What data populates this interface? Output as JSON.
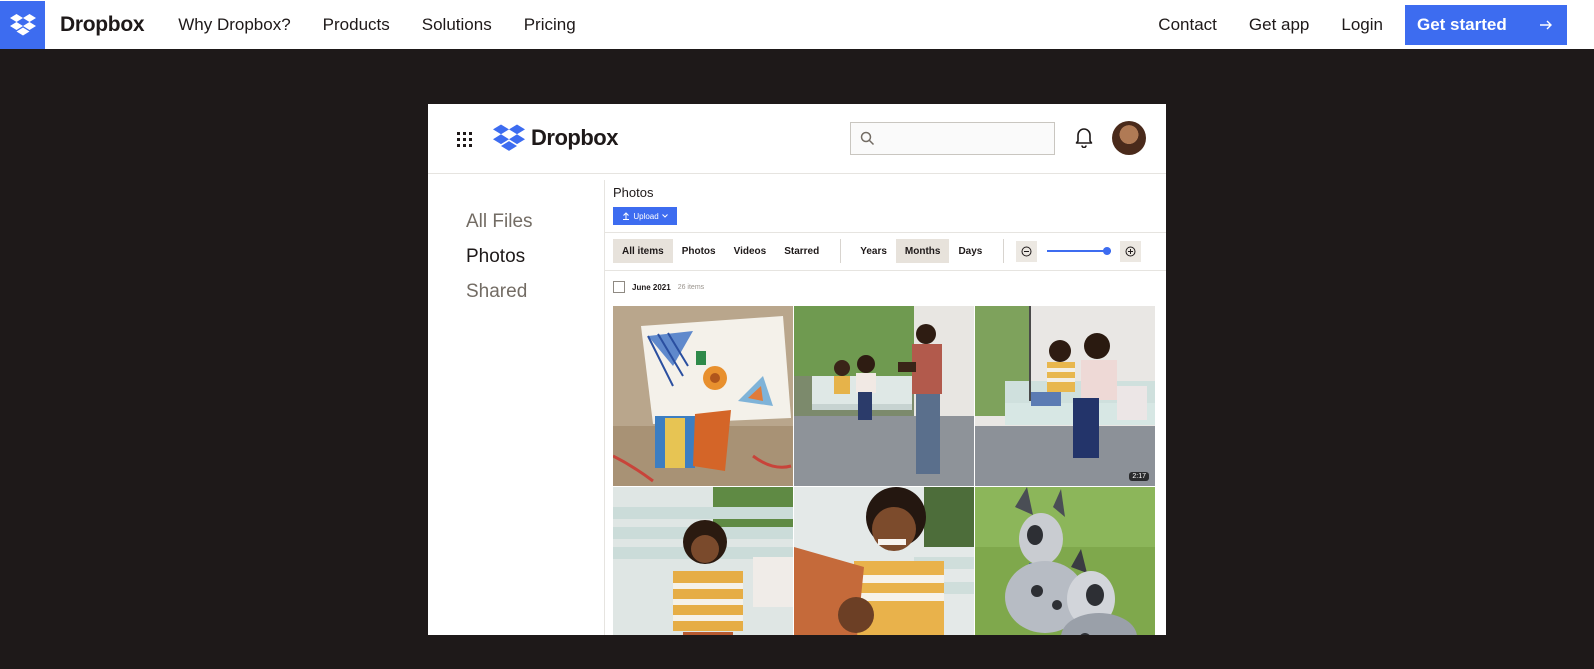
{
  "nav": {
    "brand": "Dropbox",
    "links": [
      "Why Dropbox?",
      "Products",
      "Solutions",
      "Pricing"
    ],
    "right_links": [
      "Contact",
      "Get app",
      "Login"
    ],
    "cta_label": "Get started",
    "cta_icon": "arrow-right-icon"
  },
  "colors": {
    "brand_blue": "#3d6cf0",
    "background": "#1e1919"
  },
  "app": {
    "brand": "Dropbox",
    "sidebar": [
      "All Files",
      "Photos",
      "Shared"
    ],
    "sidebar_active": "Photos",
    "page_title": "Photos",
    "upload_label": "Upload",
    "filter_tabs": [
      "All items",
      "Photos",
      "Videos",
      "Starred"
    ],
    "filter_selected": "All items",
    "time_tabs": [
      "Years",
      "Months",
      "Days"
    ],
    "time_selected": "Months",
    "group_title": "June 2021",
    "group_count": "26 items",
    "video_duration": "2:17",
    "photos": [
      "collage-artwork",
      "family-porch-swing-photo",
      "mother-son-porch-swing",
      "boy-on-bench",
      "boy-laughing-selfie",
      "two-dogs-on-grass"
    ]
  }
}
